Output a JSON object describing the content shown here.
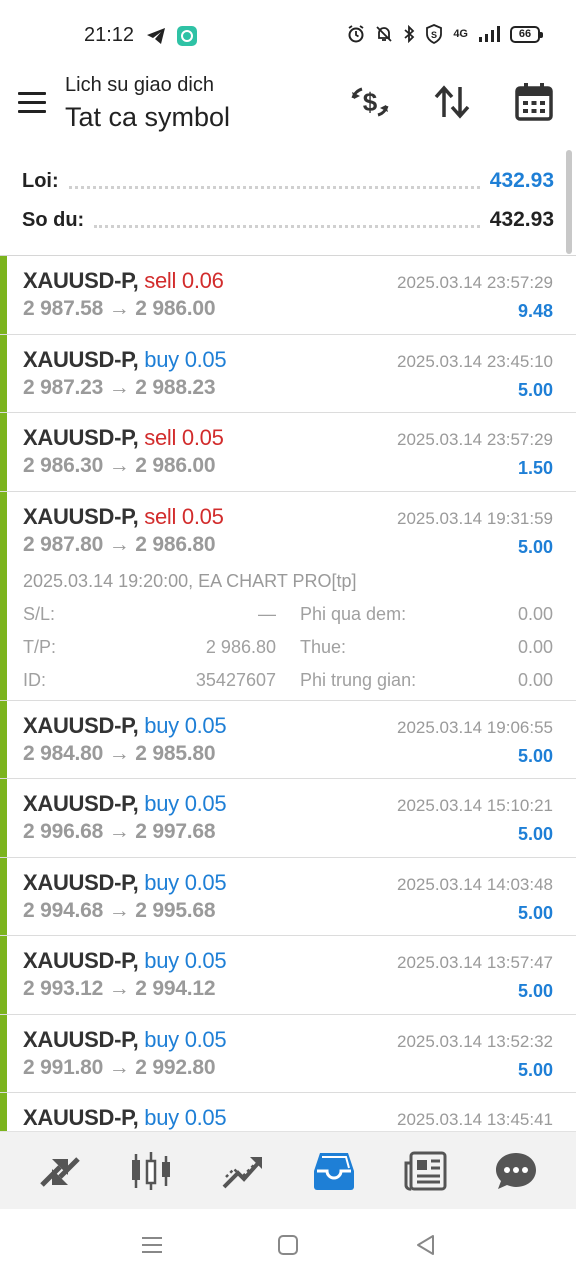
{
  "status_bar": {
    "time": "21:12",
    "icons": [
      "telegram-icon",
      "app-notification-icon",
      "alarm-icon",
      "mute-icon",
      "bluetooth-icon",
      "shield-icon",
      "4g-signal-icon",
      "signal-icon",
      "battery-icon"
    ],
    "network_label": "4G",
    "battery_level": "66"
  },
  "header": {
    "subtitle": "Lich su giao dich",
    "title": "Tat ca symbol",
    "icons": [
      "currency-exchange-icon",
      "sort-icon",
      "calendar-icon"
    ]
  },
  "summary": {
    "profit_label": "Loi:",
    "profit_value": "432.93",
    "balance_label": "So du:",
    "balance_value": "432.93",
    "profit_color": "#1e7fd6"
  },
  "deals": [
    {
      "symbol": "XAUUSD-P,",
      "side": "sell",
      "volume": "0.06",
      "open": "2 987.58",
      "close": "2 986.00",
      "time": "2025.03.14 23:57:29",
      "profit": "9.48"
    },
    {
      "symbol": "XAUUSD-P,",
      "side": "buy",
      "volume": "0.05",
      "open": "2 987.23",
      "close": "2 988.23",
      "time": "2025.03.14 23:45:10",
      "profit": "5.00"
    },
    {
      "symbol": "XAUUSD-P,",
      "side": "sell",
      "volume": "0.05",
      "open": "2 986.30",
      "close": "2 986.00",
      "time": "2025.03.14 23:57:29",
      "profit": "1.50"
    },
    {
      "symbol": "XAUUSD-P,",
      "side": "sell",
      "volume": "0.05",
      "open": "2 987.80",
      "close": "2 986.80",
      "time": "2025.03.14 19:31:59",
      "profit": "5.00"
    },
    {
      "symbol": "XAUUSD-P,",
      "side": "buy",
      "volume": "0.05",
      "open": "2 984.80",
      "close": "2 985.80",
      "time": "2025.03.14 19:06:55",
      "profit": "5.00"
    },
    {
      "symbol": "XAUUSD-P,",
      "side": "buy",
      "volume": "0.05",
      "open": "2 996.68",
      "close": "2 997.68",
      "time": "2025.03.14 15:10:21",
      "profit": "5.00"
    },
    {
      "symbol": "XAUUSD-P,",
      "side": "buy",
      "volume": "0.05",
      "open": "2 994.68",
      "close": "2 995.68",
      "time": "2025.03.14 14:03:48",
      "profit": "5.00"
    },
    {
      "symbol": "XAUUSD-P,",
      "side": "buy",
      "volume": "0.05",
      "open": "2 993.12",
      "close": "2 994.12",
      "time": "2025.03.14 13:57:47",
      "profit": "5.00"
    },
    {
      "symbol": "XAUUSD-P,",
      "side": "buy",
      "volume": "0.05",
      "open": "2 991.80",
      "close": "2 992.80",
      "time": "2025.03.14 13:52:32",
      "profit": "5.00"
    },
    {
      "symbol": "XAUUSD-P,",
      "side": "buy",
      "volume": "0.05",
      "open": "",
      "close": "",
      "time": "2025.03.14 13:45:41",
      "profit": ""
    }
  ],
  "expanded_detail": {
    "row_index": 3,
    "open_info": "2025.03.14 19:20:00, EA CHART PRO[tp]",
    "sl_label": "S/L:",
    "sl_value": "—",
    "tp_label": "T/P:",
    "tp_value": "2 986.80",
    "id_label": "ID:",
    "id_value": "35427607",
    "swap_label": "Phi qua dem:",
    "swap_value": "0.00",
    "tax_label": "Thue:",
    "tax_value": "0.00",
    "commission_label": "Phi trung gian:",
    "commission_value": "0.00"
  },
  "arrow": "→",
  "colors": {
    "sell": "#d22c2c",
    "buy": "#1e7fd6",
    "profit": "#1e7fd6",
    "bar": "#7cb41e",
    "active_tab": "#1e7fd6"
  },
  "bottom_nav": {
    "items": [
      "quotes-icon",
      "chart-icon",
      "trade-icon",
      "history-icon",
      "news-icon",
      "messages-icon"
    ],
    "active": "history-icon"
  },
  "system_nav": [
    "recents-icon",
    "home-icon",
    "back-icon"
  ]
}
